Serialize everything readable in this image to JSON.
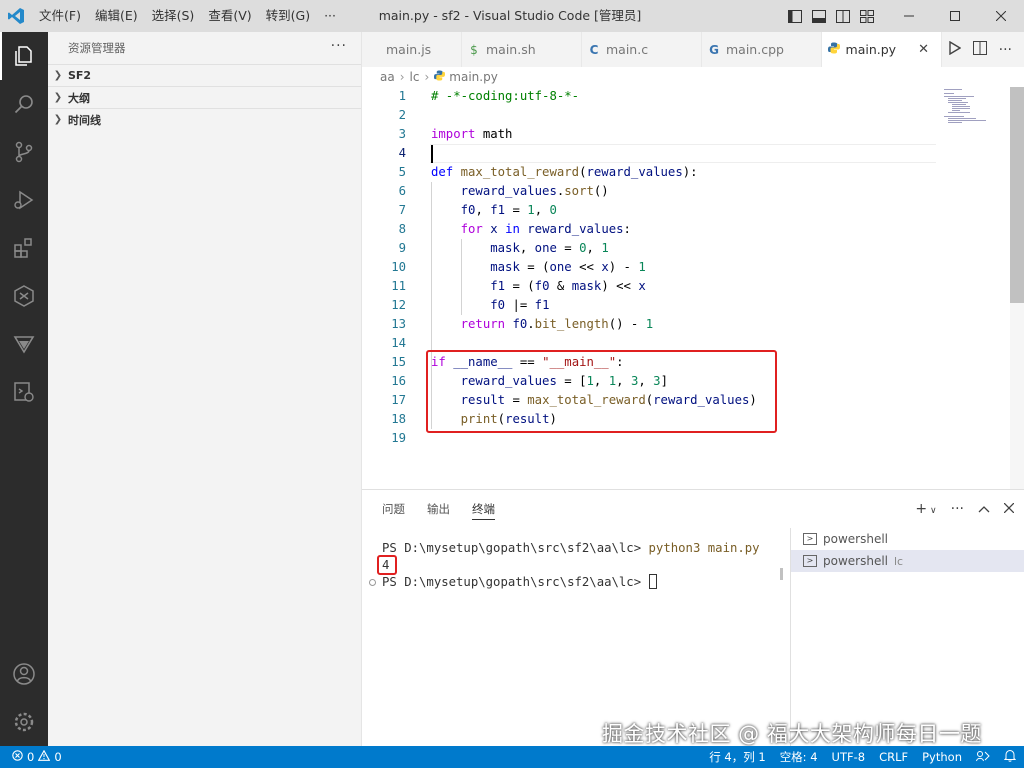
{
  "window": {
    "title": "main.py - sf2 - Visual Studio Code [管理员]",
    "menu": [
      "文件(F)",
      "编辑(E)",
      "选择(S)",
      "查看(V)",
      "转到(G)",
      "···"
    ],
    "controls": [
      "minimize",
      "maximize",
      "close"
    ]
  },
  "activity_bar": {
    "items": [
      "explorer-icon",
      "search-icon",
      "source-control-icon",
      "run-debug-icon",
      "extensions-icon",
      "git-graph-icon",
      "deploy-icon",
      "remote-icon"
    ],
    "bottom": [
      "account-icon",
      "settings-gear-icon"
    ]
  },
  "sidebar": {
    "title": "资源管理器",
    "more": "···",
    "sections": [
      "SF2",
      "大纲",
      "时间线"
    ]
  },
  "tabs": [
    {
      "label": "main.js",
      "icon": "",
      "active": false
    },
    {
      "label": "main.sh",
      "icon": "$",
      "active": false
    },
    {
      "label": "main.c",
      "icon": "C",
      "active": false
    },
    {
      "label": "main.cpp",
      "icon": "G",
      "active": false
    },
    {
      "label": "main.py",
      "icon": "python-icon",
      "active": true
    }
  ],
  "breadcrumb": [
    "aa",
    "lc",
    "main.py"
  ],
  "editor": {
    "current_line": 4,
    "lines": [
      "1",
      "2",
      "3",
      "4",
      "5",
      "6",
      "7",
      "8",
      "9",
      "10",
      "11",
      "12",
      "13",
      "14",
      "15",
      "16",
      "17",
      "18",
      "19"
    ]
  },
  "panel": {
    "tabs": [
      "问题",
      "输出",
      "终端"
    ],
    "active_tab": "终端",
    "terminal_lines": {
      "prompt1": "PS D:\\mysetup\\gopath\\src\\sf2\\aa\\lc> ",
      "command": "python3 main.py",
      "output": "4",
      "prompt2": "PS D:\\mysetup\\gopath\\src\\sf2\\aa\\lc> "
    },
    "terminals": [
      {
        "label": "powershell",
        "sub": "",
        "selected": false
      },
      {
        "label": "powershell",
        "sub": "lc",
        "selected": true
      }
    ]
  },
  "status_bar": {
    "errors": "0",
    "warnings": "0",
    "position": "行 4，列 1",
    "spaces": "空格: 4",
    "encoding": "UTF-8",
    "eol": "CRLF",
    "language": "Python"
  },
  "watermark": "掘金技术社区 @ 福大大架构师每日一题",
  "colors": {
    "accent": "#007acc",
    "highlight_box": "#e02020",
    "activity_bg": "#2c2c2c"
  }
}
